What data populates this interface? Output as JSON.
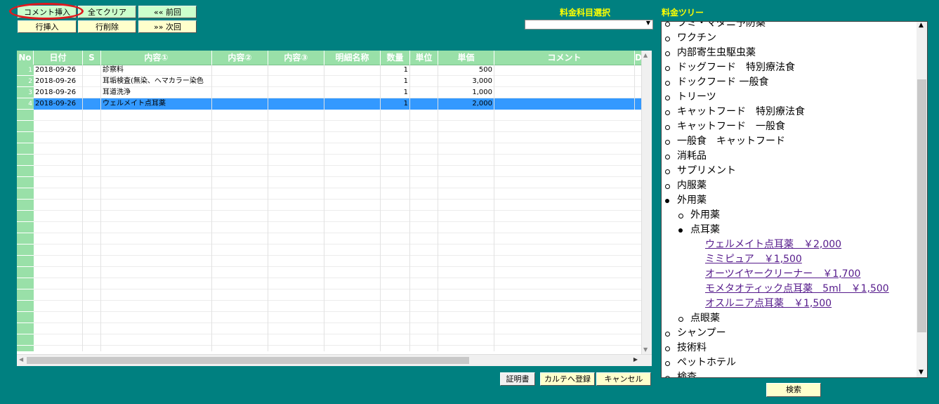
{
  "toolbar": {
    "comment_insert": "コメント挿入",
    "clear_all": "全てクリア",
    "prev": "«« 前回",
    "row_insert": "行挿入",
    "row_delete": "行削除",
    "next": "»» 次回"
  },
  "fee_item_select_label": "料金科目選択",
  "fee_tree_label": "料金ツリー",
  "grid": {
    "columns": [
      "No",
      "日付",
      "S",
      "内容①",
      "内容②",
      "内容③",
      "明細名称",
      "数量",
      "単位",
      "単価",
      "コメント",
      "D"
    ],
    "rows": [
      {
        "no": "1",
        "date": "2018-09-26",
        "s": "",
        "c1": "診察料",
        "c2": "",
        "c3": "",
        "detail": "",
        "qty": "1",
        "unit": "",
        "price": "500",
        "comment": ""
      },
      {
        "no": "2",
        "date": "2018-09-26",
        "s": "",
        "c1": "耳垢検査(無染、ヘマカラー染色",
        "c2": "",
        "c3": "",
        "detail": "",
        "qty": "1",
        "unit": "",
        "price": "3,000",
        "comment": ""
      },
      {
        "no": "3",
        "date": "2018-09-26",
        "s": "",
        "c1": "耳道洗浄",
        "c2": "",
        "c3": "",
        "detail": "",
        "qty": "1",
        "unit": "",
        "price": "1,000",
        "comment": ""
      },
      {
        "no": "4",
        "date": "2018-09-26",
        "s": "",
        "c1": "ウェルメイト点耳薬",
        "c2": "",
        "c3": "",
        "detail": "",
        "qty": "1",
        "unit": "",
        "price": "2,000",
        "comment": ""
      }
    ]
  },
  "bottom_buttons": {
    "certificate": "証明書",
    "register_chart": "カルテへ登録",
    "cancel": "キャンセル",
    "search": "検索"
  },
  "tree": {
    "items": [
      {
        "level": 1,
        "bullet": "open",
        "label": "フミ・マダニ予防薬"
      },
      {
        "level": 1,
        "bullet": "open",
        "label": "ワクチン"
      },
      {
        "level": 1,
        "bullet": "open",
        "label": "内部寄生虫駆虫薬"
      },
      {
        "level": 1,
        "bullet": "open",
        "label": "ドッグフード　特別療法食"
      },
      {
        "level": 1,
        "bullet": "open",
        "label": "ドックフード 一般食"
      },
      {
        "level": 1,
        "bullet": "open",
        "label": "トリーツ"
      },
      {
        "level": 1,
        "bullet": "open",
        "label": "キャットフード　特別療法食"
      },
      {
        "level": 1,
        "bullet": "open",
        "label": "キャットフード　一般食"
      },
      {
        "level": 1,
        "bullet": "open",
        "label": "一般食　キャットフード"
      },
      {
        "level": 1,
        "bullet": "open",
        "label": "消耗品"
      },
      {
        "level": 1,
        "bullet": "open",
        "label": "サプリメント"
      },
      {
        "level": 1,
        "bullet": "open",
        "label": "内服薬"
      },
      {
        "level": 1,
        "bullet": "filled",
        "label": "外用薬"
      },
      {
        "level": 2,
        "bullet": "open",
        "label": "外用薬"
      },
      {
        "level": 2,
        "bullet": "filled",
        "label": "点耳薬"
      },
      {
        "level": 3,
        "bullet": "none",
        "label": "ウェルメイト点耳薬　￥2,000",
        "link": true
      },
      {
        "level": 3,
        "bullet": "none",
        "label": "ミミピュア　￥1,500",
        "link": true
      },
      {
        "level": 3,
        "bullet": "none",
        "label": "オーツイヤークリーナー　￥1,700",
        "link": true
      },
      {
        "level": 3,
        "bullet": "none",
        "label": "モメタオティック点耳薬　5ml　￥1,500",
        "link": true
      },
      {
        "level": 3,
        "bullet": "none",
        "label": "オスルニア点耳薬　￥1,500",
        "link": true
      },
      {
        "level": 2,
        "bullet": "open",
        "label": "点眼薬"
      },
      {
        "level": 1,
        "bullet": "open",
        "label": "シャンプー"
      },
      {
        "level": 1,
        "bullet": "open",
        "label": "技術料"
      },
      {
        "level": 1,
        "bullet": "open",
        "label": "ペットホテル"
      },
      {
        "level": 1,
        "bullet": "open",
        "label": "検査"
      }
    ]
  },
  "colors": {
    "background": "#008080",
    "header_green": "#99e0a8",
    "selected_row": "#3399ff",
    "label_yellow": "#ffff00",
    "highlight_ring": "#e0191e"
  }
}
